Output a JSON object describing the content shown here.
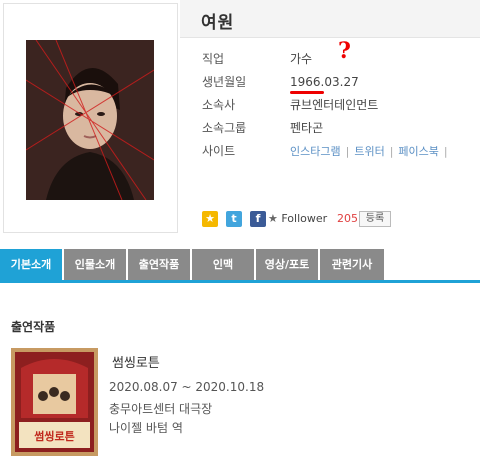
{
  "profile": {
    "name": "여원",
    "rows": [
      {
        "label": "직업",
        "value": "가수"
      },
      {
        "label": "생년월일",
        "value": "1966.03.27"
      },
      {
        "label": "소속사",
        "value": "큐브엔터테인먼트"
      },
      {
        "label": "소속그룹",
        "value": "펜타곤"
      },
      {
        "label": "사이트",
        "value": ""
      }
    ],
    "annotation_mark": "?",
    "sites": [
      "인스타그램",
      "트위터",
      "페이스북"
    ],
    "social": {
      "follower_label": "Follower",
      "follower_count": "205",
      "register_label": "등록"
    }
  },
  "tabs": [
    "기본소개",
    "인물소개",
    "출연작품",
    "인맥",
    "영상/포토",
    "관련기사"
  ],
  "works_section": {
    "title": "출연작품",
    "items": [
      {
        "title": "썸씽로튼",
        "period": "2020.08.07 ~ 2020.10.18",
        "venue": "충무아트센터 대극장",
        "role": "나이젤 바텀 역",
        "poster_text": "썸씽로튼"
      }
    ]
  },
  "colors": {
    "tab_active": "#1fa2d6",
    "tab_inactive": "#8a8a8a",
    "follower_count": "#e04040",
    "annotation": "#e00000",
    "link": "#5a8fc4"
  }
}
